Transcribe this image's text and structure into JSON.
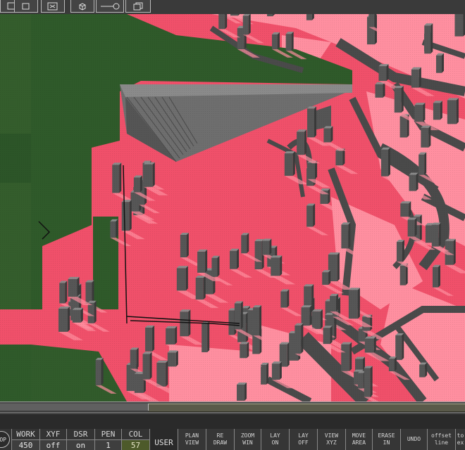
{
  "toolbar": {
    "icons": [
      "square-icon",
      "square-small-icon",
      "swap-icon",
      "cube-icon",
      "line-circle-icon",
      "layers-icon"
    ]
  },
  "viewport": {
    "colors": {
      "road": "#f0506a",
      "pale": "#ff8fa0",
      "park": "#2f5a2a",
      "building": "#555555",
      "building_light": "#777777"
    }
  },
  "status": {
    "stop": "OP",
    "cells": [
      {
        "label": "WORK",
        "value": "450"
      },
      {
        "label": "XYF",
        "value": "off"
      },
      {
        "label": "DSR",
        "value": "on"
      },
      {
        "label": "PEN",
        "value": "1"
      },
      {
        "label": "COL",
        "value": "57"
      }
    ],
    "user": "USER"
  },
  "commands": [
    {
      "label": "PLAN\nVIEW"
    },
    {
      "label": "RE\nDRAW"
    },
    {
      "label": "ZOOM\nWIN"
    },
    {
      "label": "LAY\nON"
    },
    {
      "label": "LAY\nOFF"
    },
    {
      "label": "VIEW\nXYZ"
    },
    {
      "label": "MOVE\nAREA"
    },
    {
      "label": "ERASE\nIN"
    },
    {
      "label": "UNDO"
    },
    {
      "label": "offset\nline"
    },
    {
      "label": "to\nex"
    }
  ]
}
